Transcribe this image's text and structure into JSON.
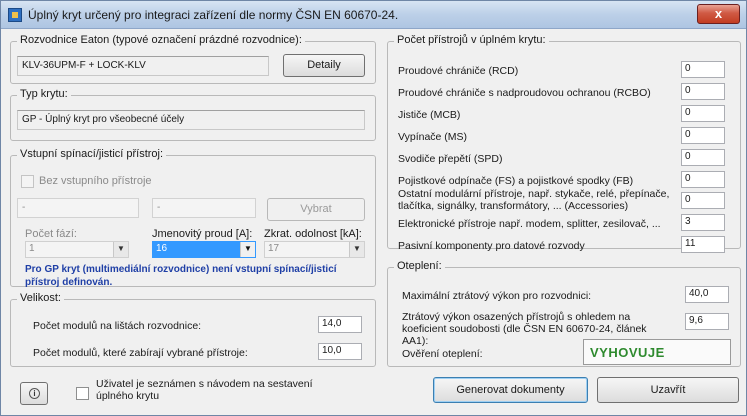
{
  "window": {
    "title": "Úplný kryt určený pro integraci zařízení dle normy ČSN EN 60670-24.",
    "close_label": "x"
  },
  "rozvodnice": {
    "legend": "Rozvodnice Eaton (typové označení prázdné rozvodnice):",
    "value": "KLV-36UPM-F + LOCK-KLV",
    "detail_button": "Detaily"
  },
  "typ_krytu": {
    "legend": "Typ krytu:",
    "value": "GP - Úplný kryt pro všeobecné účely"
  },
  "vstupni": {
    "legend": "Vstupní spínací/jisticí přístroj:",
    "checkbox_label": "Bez vstupního přístroje",
    "field1": "-",
    "field2": "-",
    "select_button": "Vybrat",
    "faze_label": "Počet fází:",
    "faze_value": "1",
    "proud_label": "Jmenovitý proud [A]:",
    "proud_value": "16",
    "odolnost_label": "Zkrat. odolnost [kA]:",
    "odolnost_value": "17",
    "note": "Pro GP kryt (multimediální rozvodnice) není vstupní spínací/jisticí přístroj definován."
  },
  "velikost": {
    "legend": "Velikost:",
    "rows": [
      {
        "label": "Počet modulů na lištách rozvodnice:",
        "value": "14,0"
      },
      {
        "label": "Počet modulů, které zabírají vybrané přístroje:",
        "value": "10,0"
      }
    ]
  },
  "pocet": {
    "legend": "Počet přístrojů v úplném krytu:",
    "rows": [
      {
        "label": "Proudové chrániče (RCD)",
        "value": "0"
      },
      {
        "label": "Proudové chrániče s nadproudovou ochranou (RCBO)",
        "value": "0"
      },
      {
        "label": "Jističe (MCB)",
        "value": "0"
      },
      {
        "label": "Vypínače (MS)",
        "value": "0"
      },
      {
        "label": "Svodiče přepětí (SPD)",
        "value": "0"
      },
      {
        "label": "Pojistkové odpínače (FS) a pojistkové spodky (FB)",
        "value": "0"
      },
      {
        "label": "Ostatní modulární přístroje, např. stykače, relé, přepínače, tlačítka, signálky, transformátory, ...   (Accessories)",
        "value": "0"
      },
      {
        "label": "Elektronické přístroje např. modem, splitter, zesilovač, ...",
        "value": "3"
      },
      {
        "label": "Pasivní komponenty pro datové rozvody",
        "value": "11"
      }
    ]
  },
  "oteplení": {
    "legend": "Oteplení:",
    "max_label": "Maximální ztrátový výkon pro rozvodnici:",
    "max_value": "40,0",
    "ztraty_label": "Ztrátový výkon osazených přístrojů s ohledem na koeficient soudobosti (dle ČSN EN 60670-24, článek AA1):",
    "ztraty_value": "9,6",
    "overeni_label": "Ověření oteplení:",
    "overeni_value": "VYHOVUJE",
    "overeni_color": "#2e8a2e"
  },
  "footer": {
    "info_icon": "info-icon",
    "checkbox_label": "Uživatel je seznámen s návodem na sestavení úplného krytu",
    "generate_button": "Generovat dokumenty",
    "close_button": "Uzavřít"
  }
}
